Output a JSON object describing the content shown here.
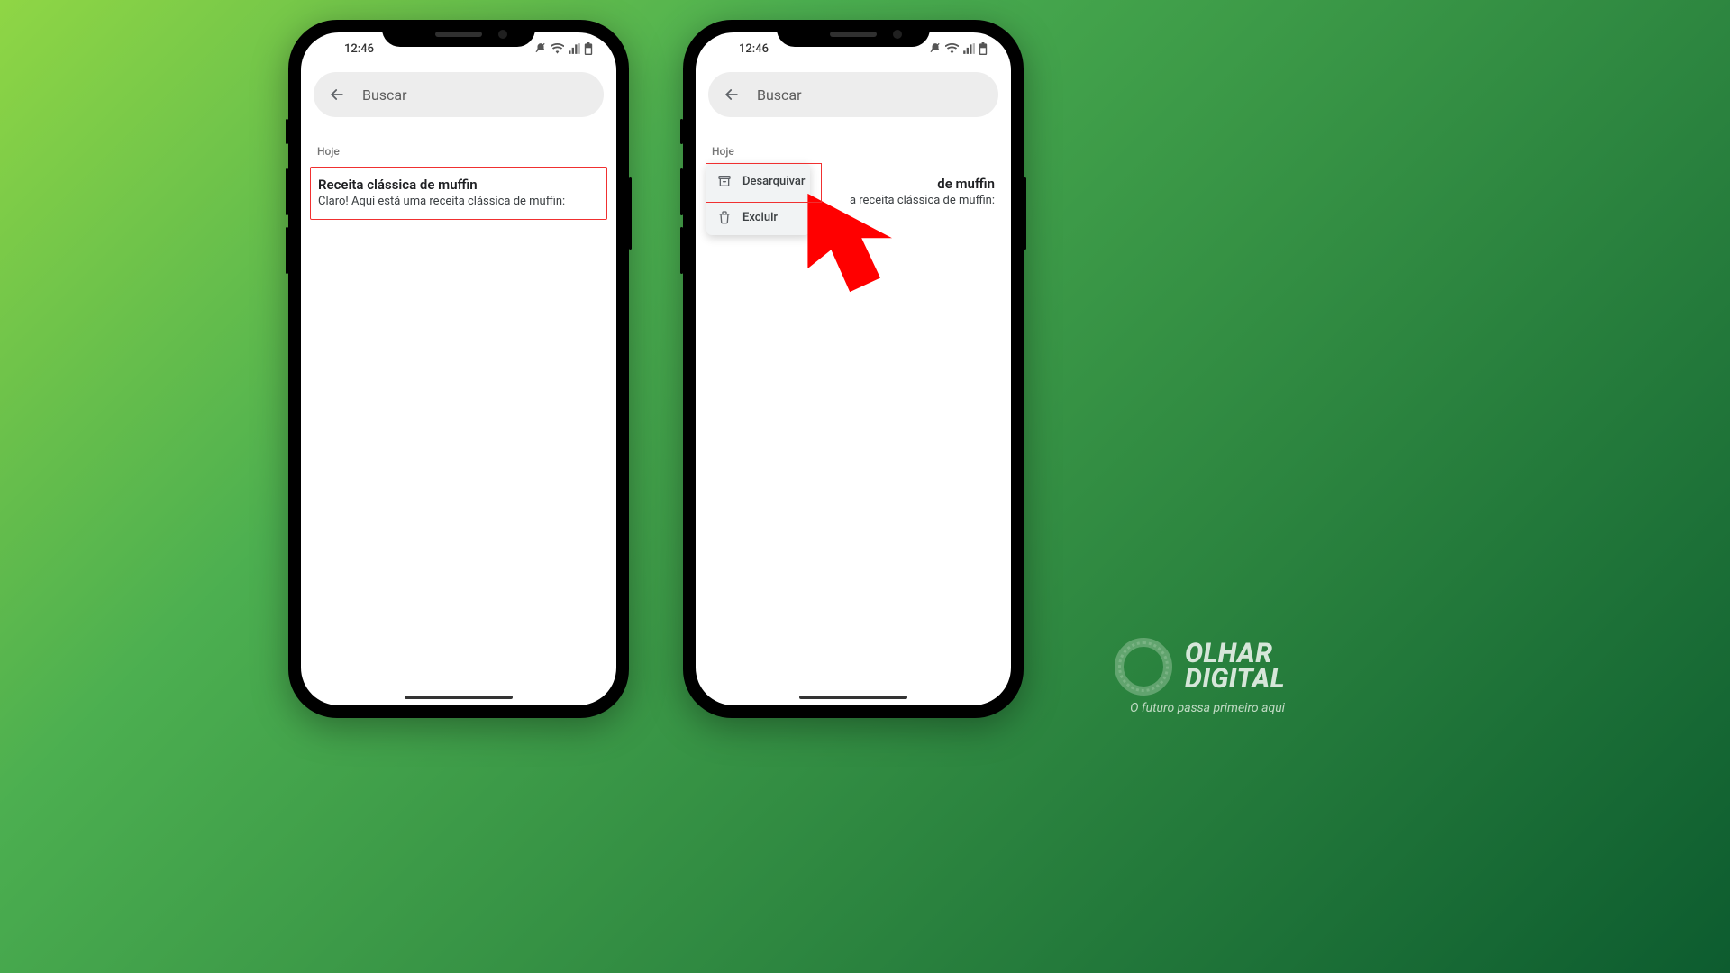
{
  "status_bar": {
    "time": "12:46"
  },
  "search": {
    "placeholder": "Buscar"
  },
  "section": {
    "label": "Hoje"
  },
  "chat": {
    "title": "Receita clássica de muffin",
    "subtitle": "Claro! Aqui está uma receita clássica de muffin:",
    "title_suffix_visible": "de muffin",
    "subtitle_suffix_visible": "a receita clássica de muffin:"
  },
  "context_menu": {
    "unarchive": "Desarquivar",
    "delete": "Excluir"
  },
  "colors": {
    "highlight_border": "#f03030",
    "arrow_fill": "#ff0000"
  },
  "brand": {
    "line1": "OLHAR",
    "line2": "DIGITAL",
    "tagline": "O futuro passa primeiro aqui"
  }
}
